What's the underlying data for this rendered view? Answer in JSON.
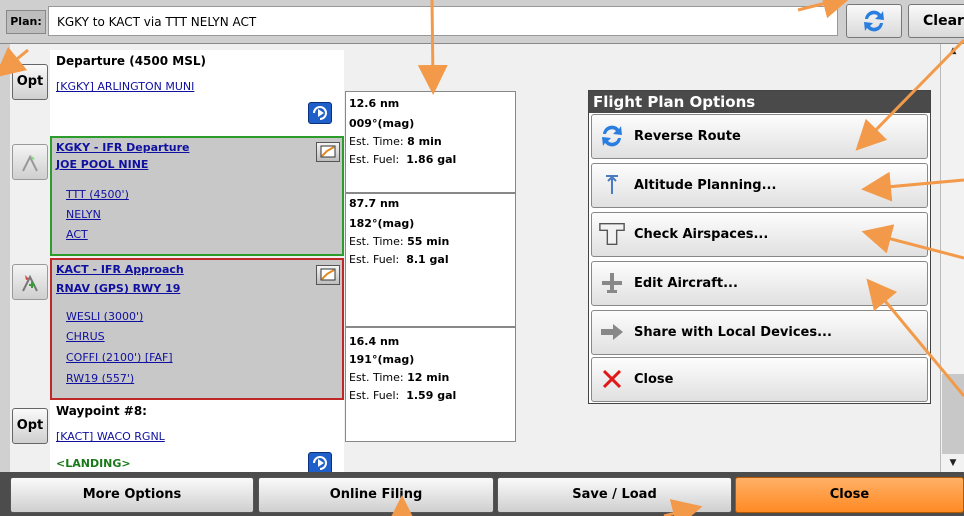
{
  "topbar": {
    "plan_label": "Plan:",
    "plan_value": "KGKY to KACT via TTT NELYN ACT",
    "clear_label": "Clear"
  },
  "left_buttons": {
    "opt_label": "Opt"
  },
  "waypoints": {
    "departure_title": "Departure (4500 MSL)",
    "departure_airport": "[KGKY] ARLINGTON MUNI",
    "dep_proc_title": "KGKY - IFR Departure",
    "dep_proc_name": "JOE POOL NINE",
    "dep_fixes": [
      "TTT (4500')",
      "NELYN",
      "ACT"
    ],
    "app_proc_title": "KACT - IFR Approach",
    "app_proc_name": "RNAV (GPS) RWY 19",
    "app_fixes": [
      "WESLI (3000')",
      "CHRUS",
      "COFFI (2100') [FAF]",
      "RW19 (557')"
    ],
    "wp8_title": "Waypoint #8:",
    "wp8_airport": "[KACT] WACO RGNL",
    "landing": "<LANDING>"
  },
  "legs": [
    {
      "dist": "12.6 nm",
      "course": "009°(mag)",
      "time_label": "Est. Time:",
      "time": "8 min",
      "fuel_label": "Est. Fuel:",
      "fuel": "1.86 gal"
    },
    {
      "dist": "87.7 nm",
      "course": "182°(mag)",
      "time_label": "Est. Time:",
      "time": "55 min",
      "fuel_label": "Est. Fuel:",
      "fuel": "8.1 gal"
    },
    {
      "dist": "16.4 nm",
      "course": "191°(mag)",
      "time_label": "Est. Time:",
      "time": "12 min",
      "fuel_label": "Est. Fuel:",
      "fuel": "1.59 gal"
    }
  ],
  "dialog": {
    "title": "Flight Plan Options",
    "options": [
      {
        "label": "Reverse Route",
        "icon": "reverse-icon"
      },
      {
        "label": "Altitude Planning...",
        "icon": "altitude-icon"
      },
      {
        "label": "Check Airspaces...",
        "icon": "airspace-icon"
      },
      {
        "label": "Edit Aircraft...",
        "icon": "aircraft-icon"
      },
      {
        "label": "Share with Local Devices...",
        "icon": "share-icon"
      },
      {
        "label": "Close",
        "icon": "close-icon"
      }
    ]
  },
  "bottombar": {
    "more_options": "More Options",
    "online_filing": "Online Filing",
    "save_load": "Save / Load",
    "close": "Close"
  },
  "colors": {
    "accent_orange": "#ff8a24",
    "dep_border": "#2c9c2c",
    "app_border": "#c02828",
    "link_blue": "#1010a0",
    "annotation_arrow": "#f39a4a"
  }
}
